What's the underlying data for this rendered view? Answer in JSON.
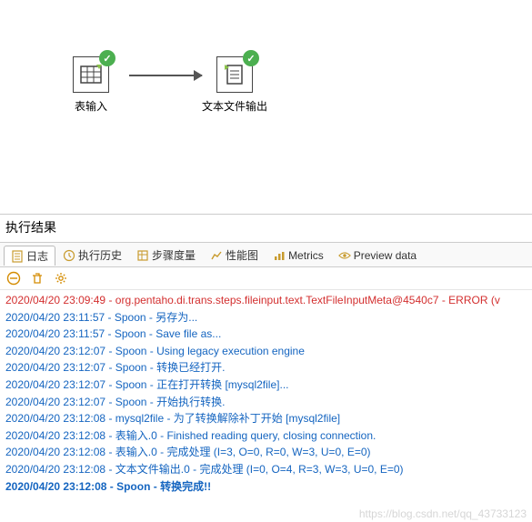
{
  "canvas": {
    "step1": {
      "label": "表输入"
    },
    "step2": {
      "label": "文本文件输出"
    }
  },
  "results": {
    "title": "执行结果",
    "tabs": {
      "log": "日志",
      "history": "执行历史",
      "metrics_cn": "步骤度量",
      "perf": "性能图",
      "metrics": "Metrics",
      "preview": "Preview data"
    },
    "logs": [
      {
        "cls": "log-red",
        "ts": "2020/04/20 23:09:49",
        "src": "org.pentaho.di.trans.steps.fileinput.text.TextFileInputMeta@4540c7",
        "msg": "ERROR (v"
      },
      {
        "cls": "log-blue",
        "ts": "2020/04/20 23:11:57",
        "src": "Spoon",
        "msg": "另存为..."
      },
      {
        "cls": "log-blue",
        "ts": "2020/04/20 23:11:57",
        "src": "Spoon",
        "msg": "Save file as..."
      },
      {
        "cls": "log-blue",
        "ts": "2020/04/20 23:12:07",
        "src": "Spoon",
        "msg": "Using legacy execution engine"
      },
      {
        "cls": "log-blue",
        "ts": "2020/04/20 23:12:07",
        "src": "Spoon",
        "msg": "转换已经打开."
      },
      {
        "cls": "log-blue",
        "ts": "2020/04/20 23:12:07",
        "src": "Spoon",
        "msg": "正在打开转换 [mysql2file]..."
      },
      {
        "cls": "log-blue",
        "ts": "2020/04/20 23:12:07",
        "src": "Spoon",
        "msg": "开始执行转换."
      },
      {
        "cls": "log-blue",
        "ts": "2020/04/20 23:12:08",
        "src": "mysql2file",
        "msg": "为了转换解除补丁开始  [mysql2file]"
      },
      {
        "cls": "log-blue",
        "ts": "2020/04/20 23:12:08",
        "src": "表输入.0",
        "msg": "Finished reading query, closing connection."
      },
      {
        "cls": "log-blue",
        "ts": "2020/04/20 23:12:08",
        "src": "表输入.0",
        "msg": "完成处理 (I=3, O=0, R=0, W=3, U=0, E=0)"
      },
      {
        "cls": "log-blue",
        "ts": "2020/04/20 23:12:08",
        "src": "文本文件输出.0",
        "msg": "完成处理 (I=0, O=4, R=3, W=3, U=0, E=0)"
      },
      {
        "cls": "log-blue log-bold",
        "ts": "2020/04/20 23:12:08",
        "src": "Spoon",
        "msg": "转换完成!!"
      }
    ]
  },
  "watermark": "https://blog.csdn.net/qq_43733123"
}
